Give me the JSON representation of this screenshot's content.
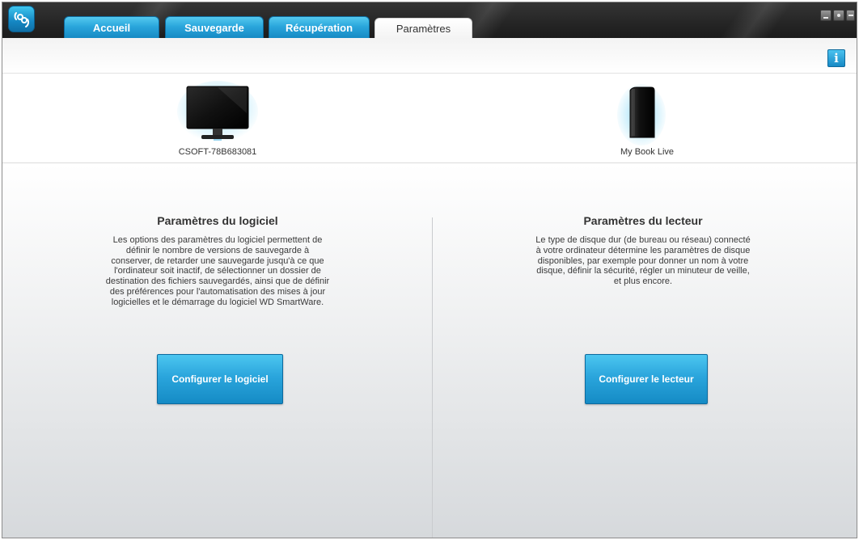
{
  "tabs": [
    {
      "label": "Accueil"
    },
    {
      "label": "Sauvegarde"
    },
    {
      "label": "Récupération"
    },
    {
      "label": "Paramètres"
    }
  ],
  "active_tab": "Paramètres",
  "devices": [
    {
      "name": "CSOFT-78B683081"
    },
    {
      "name": "My Book Live"
    }
  ],
  "software_panel": {
    "title": "Paramètres du logiciel",
    "description": "Les options des paramètres du logiciel permettent de définir le nombre de versions de sauvegarde à conserver, de retarder une sauvegarde jusqu'à ce que l'ordinateur soit inactif, de sélectionner un dossier de destination des fichiers sauvegardés, ainsi que de définir des préférences pour l'automatisation des mises à jour logicielles et le démarrage du logiciel WD SmartWare.",
    "button": "Configurer le logiciel"
  },
  "drive_panel": {
    "title": "Paramètres du lecteur",
    "description": "Le type de disque dur (de bureau ou réseau) connecté à votre ordinateur détermine les paramètres de disque disponibles, par exemple pour donner un nom à votre disque, définir la sécurité, régler un minuteur de veille, et plus encore.",
    "button": "Configurer le lecteur"
  },
  "icons": {
    "info": "info-icon",
    "logo": "wd-smartware-logo-icon",
    "computer": "monitor-icon",
    "drive": "external-drive-icon"
  },
  "colors": {
    "accent": "#1a8fcb",
    "tab_active_text": "#333333",
    "titlebar": "#262626"
  }
}
